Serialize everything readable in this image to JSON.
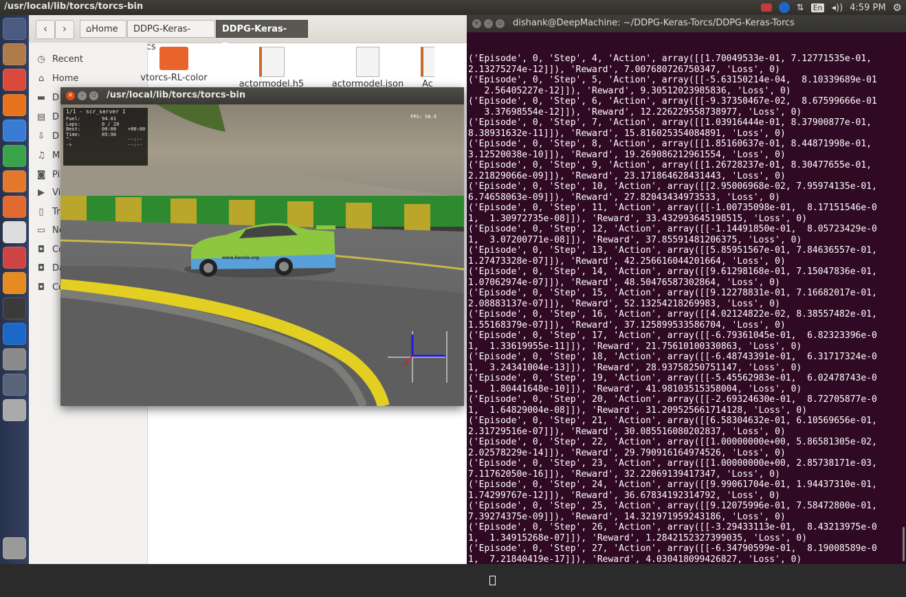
{
  "top_panel": {
    "title": "/usr/local/lib/torcs/torcs-bin",
    "keyboard_layout": "En",
    "clock": "4:59 PM"
  },
  "launcher": {
    "items": [
      {
        "name": "dash-icon",
        "color": "#4a5a80"
      },
      {
        "name": "files-icon",
        "color": "#b07b4a"
      },
      {
        "name": "chrome-icon",
        "color": "#d94a3a"
      },
      {
        "name": "firefox-icon",
        "color": "#e8731c"
      },
      {
        "name": "writer-icon",
        "color": "#3a7bd5"
      },
      {
        "name": "calc-icon",
        "color": "#3aa34a"
      },
      {
        "name": "impress-icon",
        "color": "#e3772b"
      },
      {
        "name": "software-center-icon",
        "color": "#e06a2f"
      },
      {
        "name": "amazon-icon",
        "color": "#dddddd"
      },
      {
        "name": "system-settings-icon",
        "color": "#cc4444"
      },
      {
        "name": "sublime-icon",
        "color": "#e68a22"
      },
      {
        "name": "terminal-icon",
        "color": "#3a3a3a"
      },
      {
        "name": "teamviewer-icon",
        "color": "#1b68c8"
      },
      {
        "name": "help-icon",
        "color": "#8a8a8a"
      },
      {
        "name": "window-icon",
        "color": "#5a6478"
      },
      {
        "name": "drive-icon",
        "color": "#aaaaaa"
      },
      {
        "name": "trash-icon",
        "color": "#9a9a9a"
      }
    ]
  },
  "files": {
    "breadcrumbs": [
      "Home",
      "DDPG-Keras-Torcs",
      "DDPG-Keras-Torcs"
    ],
    "sidebar": [
      {
        "icon": "recent-icon",
        "glyph": "◷",
        "label": "Recent"
      },
      {
        "icon": "home-icon",
        "glyph": "⌂",
        "label": "Home"
      },
      {
        "icon": "desktop-icon",
        "glyph": "▬",
        "label": "D"
      },
      {
        "icon": "documents-icon",
        "glyph": "▤",
        "label": "D"
      },
      {
        "icon": "downloads-icon",
        "glyph": "⇩",
        "label": "D"
      },
      {
        "icon": "music-icon",
        "glyph": "♫",
        "label": "M"
      },
      {
        "icon": "pictures-icon",
        "glyph": "◙",
        "label": "Pi"
      },
      {
        "icon": "videos-icon",
        "glyph": "▶",
        "label": "Vi"
      },
      {
        "icon": "trash-icon",
        "glyph": "▯",
        "label": "Tr"
      },
      {
        "icon": "network-icon",
        "glyph": "▭",
        "label": "Ne"
      },
      {
        "icon": "computer-icon",
        "glyph": "◘",
        "label": "Co"
      },
      {
        "icon": "drive-icon",
        "glyph": "◘",
        "label": "Da"
      },
      {
        "icon": "connect-icon",
        "glyph": "◘",
        "label": "Co"
      }
    ],
    "items": [
      {
        "label": "vtorcs-RL-color",
        "type": "folder"
      },
      {
        "label": "actormodel.h5",
        "type": "doc"
      },
      {
        "label": "actormodel.json",
        "type": "json"
      },
      {
        "label": "Ac",
        "type": "doc"
      }
    ]
  },
  "game_window": {
    "title": "/usr/local/lib/torcs/torcs-bin",
    "hud": {
      "header": "1/1 - scr_server 1",
      "rows": [
        {
          "label": "Fuel:",
          "value": "94.01",
          "extra": ""
        },
        {
          "label": "Laps:",
          "value": "0 / 20",
          "extra": ""
        },
        {
          "label": "Best:",
          "value": "00:00",
          "extra": "+00:00"
        },
        {
          "label": "Time:",
          "value": "05:96",
          "extra": ""
        },
        {
          "label": "^-",
          "value": "",
          "extra": "--:--"
        },
        {
          "label": "->",
          "value": "",
          "extra": "--:--"
        }
      ]
    },
    "fps": "FPS: 58.9",
    "car_text": "www.bernie.org"
  },
  "terminal": {
    "title": "dishank@DeepMachine: ~/DDPG-Keras-Torcs/DDPG-Keras-Torcs",
    "lines": [
      "('Episode', 0, 'Step', 4, 'Action', array([[1.70049533e-01, 7.12771535e-01,",
      "2.13275274e-12]]), 'Reward', 7.007680726750347, 'Loss', 0)",
      "('Episode', 0, 'Step', 5, 'Action', array([[-5.63150214e-04,  8.10339689e-01",
      "   2.56405227e-12]]), 'Reward', 9.30512023985836, 'Loss', 0)",
      "('Episode', 0, 'Step', 6, 'Action', array([[-9.37350467e-02,  8.67599666e-01",
      "   3.37698554e-12]]), 'Reward', 12.226229558738977, 'Loss', 0)",
      "('Episode', 0, 'Step', 7, 'Action', array([[1.03916444e-01, 8.37900877e-01,",
      "8.38931632e-11]]), 'Reward', 15.816025354084891, 'Loss', 0)",
      "('Episode', 0, 'Step', 8, 'Action', array([[1.85160637e-01, 8.44871998e-01,",
      "3.12520038e-10]]), 'Reward', 19.269086212961554, 'Loss', 0)",
      "('Episode', 0, 'Step', 9, 'Action', array([[1.26728237e-01, 8.30477655e-01,",
      "2.21829066e-09]]), 'Reward', 23.171864628431443, 'Loss', 0)",
      "('Episode', 0, 'Step', 10, 'Action', array([[2.95006968e-02, 7.95974135e-01,",
      "6.74658063e-09]]), 'Reward', 27.82043434973533, 'Loss', 0)",
      "('Episode', 0, 'Step', 11, 'Action', array([[-1.00735098e-01,  8.17151546e-0",
      "1,  1.30972735e-08]]), 'Reward', 33.432993645198515, 'Loss', 0)",
      "('Episode', 0, 'Step', 12, 'Action', array([[-1.14491850e-01,  8.05723429e-0",
      "1,  3.07200771e-08]]), 'Reward', 37.85591481206375, 'Loss', 0)",
      "('Episode', 0, 'Step', 13, 'Action', array([[5.85951567e-01, 7.84636557e-01,",
      "1.27473328e-07]]), 'Reward', 42.256616044201664, 'Loss', 0)",
      "('Episode', 0, 'Step', 14, 'Action', array([[9.61298168e-01, 7.15047836e-01,",
      "1.07062974e-07]]), 'Reward', 48.50476587302864, 'Loss', 0)",
      "('Episode', 0, 'Step', 15, 'Action', array([[9.12278831e-01, 7.16682017e-01,",
      "2.08883137e-07]]), 'Reward', 52.13254218269983, 'Loss', 0)",
      "('Episode', 0, 'Step', 16, 'Action', array([[4.02124822e-02, 8.38557482e-01,",
      "1.55168379e-07]]), 'Reward', 37.125899533586704, 'Loss', 0)",
      "('Episode', 0, 'Step', 17, 'Action', array([[-6.79361045e-01,  6.82323396e-0",
      "1,  1.33619955e-11]]), 'Reward', 21.75610100330863, 'Loss', 0)",
      "('Episode', 0, 'Step', 18, 'Action', array([[-6.48743391e-01,  6.31717324e-0",
      "1,  3.24341004e-13]]), 'Reward', 28.93758250751147, 'Loss', 0)",
      "('Episode', 0, 'Step', 19, 'Action', array([[-5.45562983e-01,  6.02478743e-0",
      "1,  1.80441648e-10]]), 'Reward', 41.98103515358004, 'Loss', 0)",
      "('Episode', 0, 'Step', 20, 'Action', array([[-2.69324630e-01,  8.72705877e-0",
      "1,  1.64829004e-08]]), 'Reward', 31.209525661714128, 'Loss', 0)",
      "('Episode', 0, 'Step', 21, 'Action', array([[6.58304632e-01, 6.10569656e-01,",
      "2.31729516e-07]]), 'Reward', 30.085516080202837, 'Loss', 0)",
      "('Episode', 0, 'Step', 22, 'Action', array([[1.00000000e+00, 5.86581305e-02,",
      "2.02578229e-14]]), 'Reward', 29.790916164974526, 'Loss', 0)",
      "('Episode', 0, 'Step', 23, 'Action', array([[1.00000000e+00, 2.85738171e-03,",
      "7.11762050e-16]]), 'Reward', 32.22069139417347, 'Loss', 0)",
      "('Episode', 0, 'Step', 24, 'Action', array([[9.99061704e-01, 1.94437310e-01,",
      "1.74299767e-12]]), 'Reward', 36.67834192314792, 'Loss', 0)",
      "('Episode', 0, 'Step', 25, 'Action', array([[9.12075996e-01, 7.58472800e-01,",
      "7.39274375e-09]]), 'Reward', 14.321971959243186, 'Loss', 0)",
      "('Episode', 0, 'Step', 26, 'Action', array([[-3.29433113e-01,  8.43213975e-0",
      "1,  1.34915268e-07]]), 'Reward', 1.2842152327399035, 'Loss', 0)",
      "('Episode', 0, 'Step', 27, 'Action', array([[-6.34790599e-01,  8.19008589e-0",
      "1,  7.21840419e-17]]), 'Reward', 4.030418099426827, 'Loss', 0)"
    ]
  }
}
